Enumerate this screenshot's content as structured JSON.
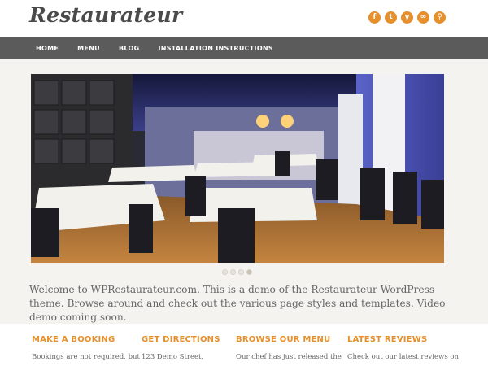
{
  "site": {
    "logo_text": "Restaurateur"
  },
  "social": [
    {
      "name": "facebook-icon",
      "glyph": "f"
    },
    {
      "name": "twitter-icon",
      "glyph": "t"
    },
    {
      "name": "yelp-icon",
      "glyph": "y"
    },
    {
      "name": "tripadvisor-icon",
      "glyph": "∞"
    },
    {
      "name": "search-icon",
      "glyph": "⚲"
    }
  ],
  "nav": {
    "items": [
      "HOME",
      "MENU",
      "BLOG",
      "INSTALLATION INSTRUCTIONS"
    ]
  },
  "slider": {
    "slide_count": 4,
    "active_index": 3
  },
  "welcome": {
    "text": "Welcome to WPRestaurateur.com. This is a demo of the Restaurateur WordPress theme. Browse around and check out the various page styles and templates. Video demo coming soon."
  },
  "widgets": [
    {
      "title": "MAKE A BOOKING",
      "text": "Bookings are not required, but"
    },
    {
      "title": "GET DIRECTIONS",
      "text": "123 Demo Street,"
    },
    {
      "title": "BROWSE OUR MENU",
      "text": "Our chef has just released the"
    },
    {
      "title": "LATEST REVIEWS",
      "text": "Check out our latest reviews on"
    }
  ],
  "colors": {
    "accent": "#e5902d",
    "nav_bg": "#5b5b5b",
    "page_bg": "#f4f3f0"
  }
}
